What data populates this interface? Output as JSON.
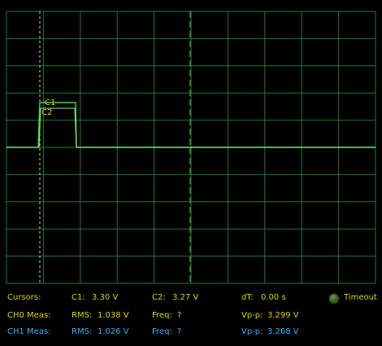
{
  "scope": {
    "trace_color": "#38e038",
    "grid_color": "#1f7a2f",
    "cursor_color": "#d8d8a0",
    "cursor_labels": [
      "C1",
      "C2"
    ]
  },
  "cursors": {
    "label": "Cursors:",
    "c1_label": "C1:",
    "c1_value": "3.30 V",
    "c2_label": "C2:",
    "c2_value": "3.27 V",
    "dt_label": "dT:",
    "dt_value": "0.00 s",
    "timeout_label": "Timeout"
  },
  "ch0": {
    "label": "CH0 Meas:",
    "rms_label": "RMS:",
    "rms_value": "1.038 V",
    "freq_label": "Freq:",
    "freq_value": "?",
    "vpp_label": "Vp-p:",
    "vpp_value": "3.299 V"
  },
  "ch1": {
    "label": "CH1 Meas:",
    "rms_label": "RMS:",
    "rms_value": "1.026 V",
    "freq_label": "Freq:",
    "freq_value": "?",
    "vpp_label": "Vp-p:",
    "vpp_value": "3.268 V"
  }
}
